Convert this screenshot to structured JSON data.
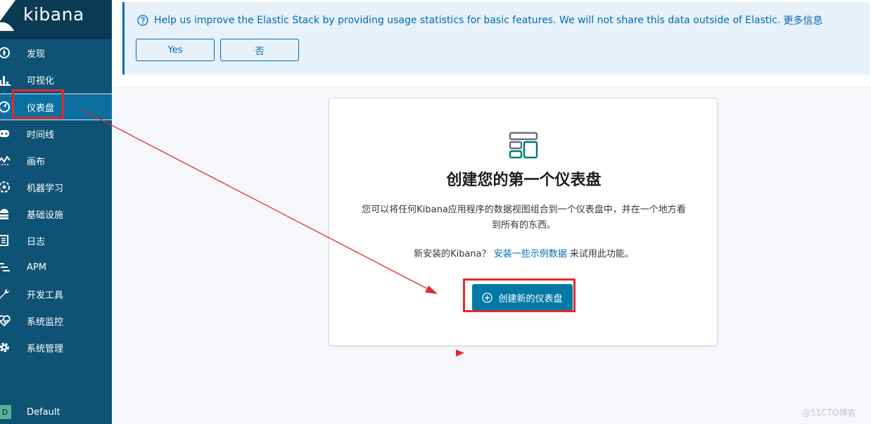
{
  "sidebar": {
    "brand": "kibana",
    "items": [
      {
        "label": "发现",
        "icon": "compass-icon"
      },
      {
        "label": "可视化",
        "icon": "bar-chart-icon"
      },
      {
        "label": "仪表盘",
        "icon": "dashboard-gauge-icon"
      },
      {
        "label": "时间线",
        "icon": "timeline-icon"
      },
      {
        "label": "画布",
        "icon": "canvas-icon"
      },
      {
        "label": "机器学习",
        "icon": "machine-learning-icon"
      },
      {
        "label": "基础设施",
        "icon": "infrastructure-icon"
      },
      {
        "label": "日志",
        "icon": "logs-icon"
      },
      {
        "label": "APM",
        "icon": "apm-icon"
      },
      {
        "label": "开发工具",
        "icon": "wrench-icon"
      },
      {
        "label": "系统监控",
        "icon": "heartbeat-icon"
      },
      {
        "label": "系统管理",
        "icon": "gear-icon"
      }
    ],
    "active_index": 2,
    "space": {
      "badge": "D",
      "label": "Default"
    }
  },
  "callout": {
    "text": "Help us improve the Elastic Stack by providing usage statistics for basic features. We will not share this data outside of Elastic.",
    "link": "更多信息",
    "yes_label": "Yes",
    "no_label": "否"
  },
  "panel": {
    "title": "创建您的第一个仪表盘",
    "description": "您可以将任何Kibana应用程序的数据视图组合到一个仪表盘中，并在一个地方看到所有的东西。",
    "new_prefix": "新安装的Kibana？",
    "new_link": "安装一些示例数据",
    "new_suffix": "来试用此功能。",
    "create_label": "创建新的仪表盘"
  },
  "watermark": "@51CTO博客",
  "colors": {
    "sidebar": "#0e5275",
    "sidebar_top": "#0b3a55",
    "accent": "#006bb4",
    "primary_button": "#0079a5",
    "annotation_red": "#e02b2b"
  }
}
